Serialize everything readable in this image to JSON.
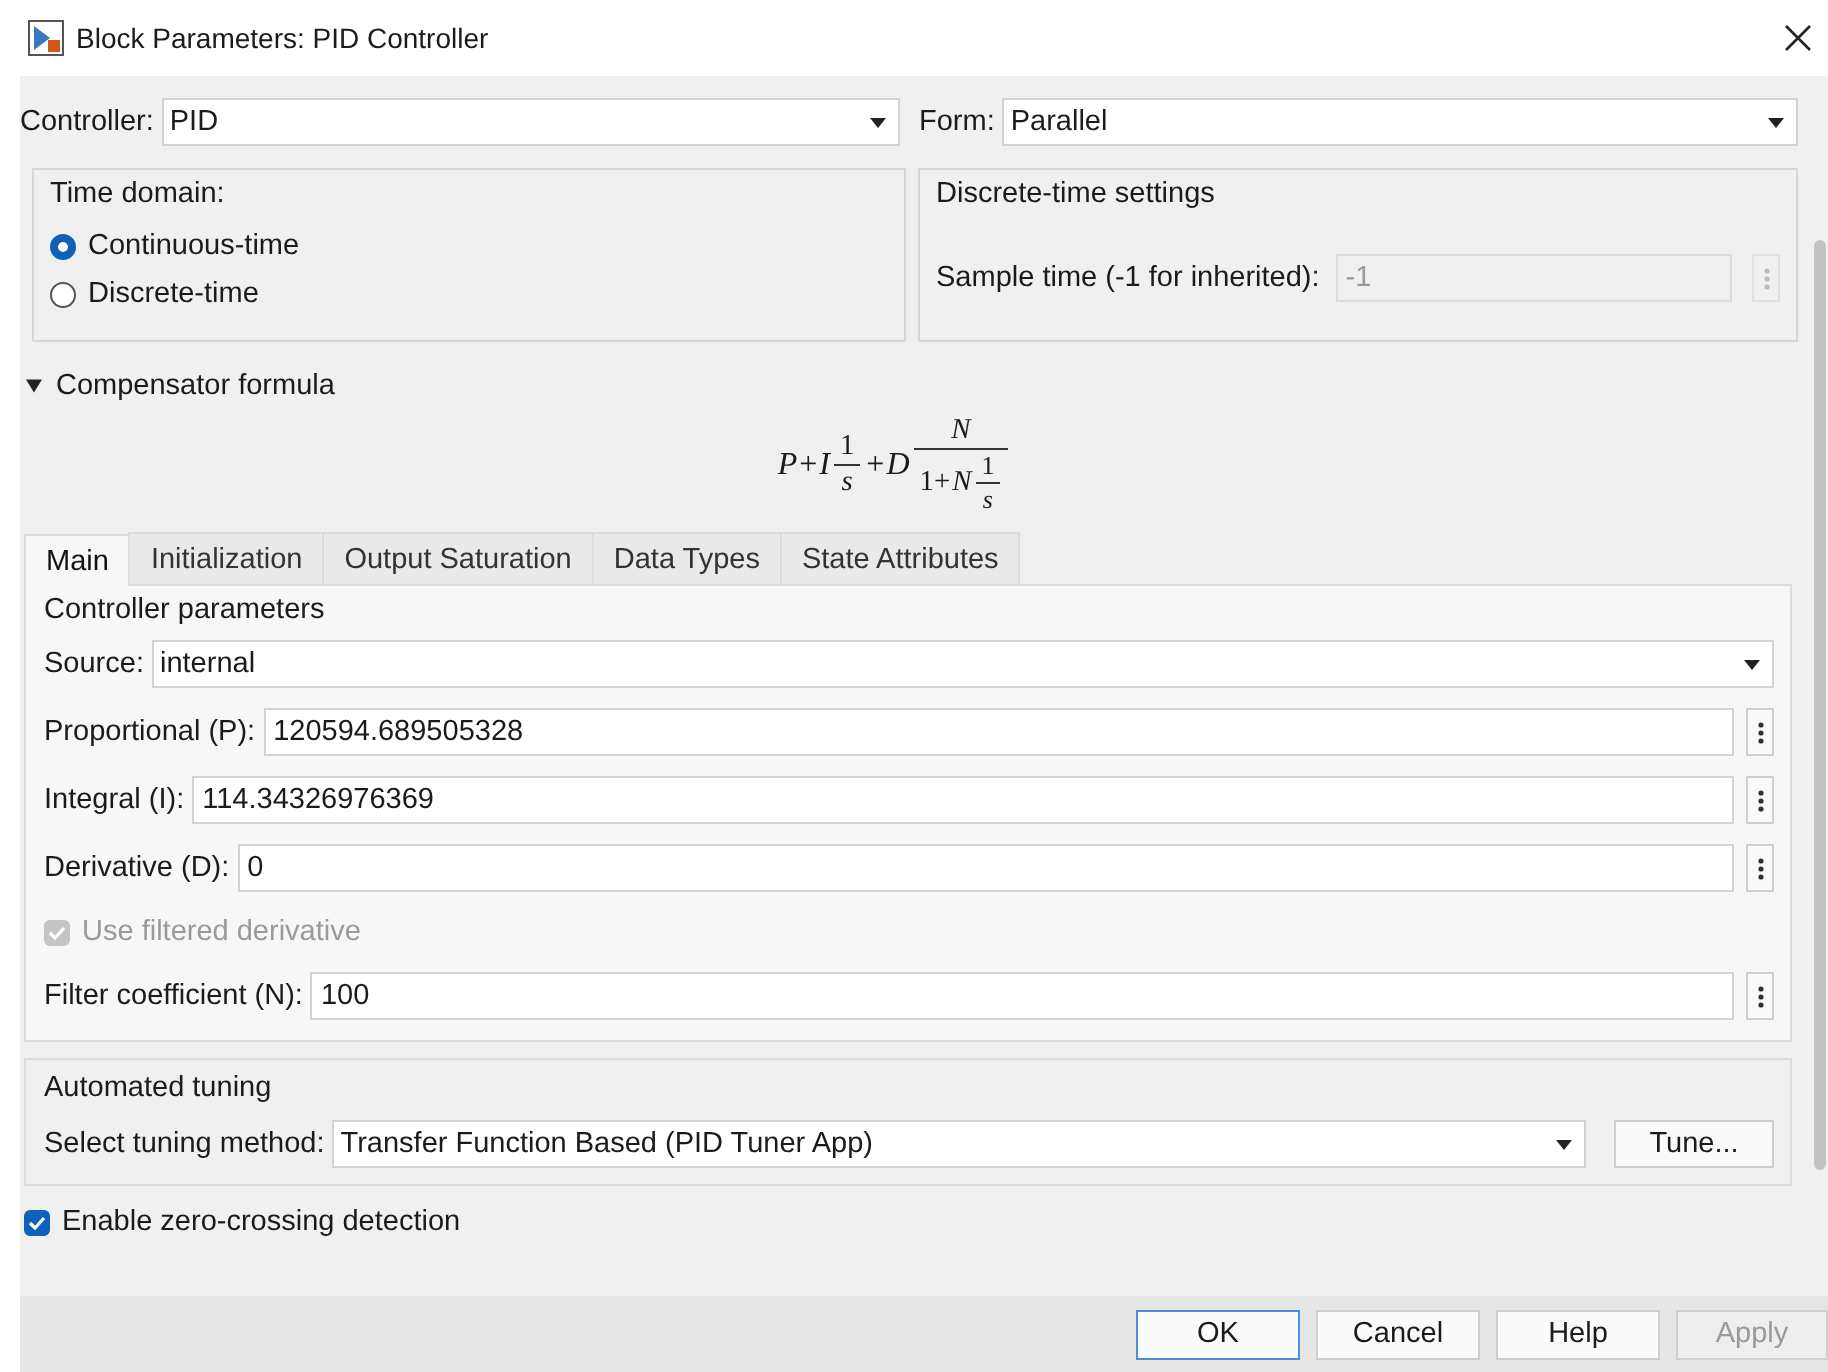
{
  "window": {
    "title": "Block Parameters: PID Controller"
  },
  "controller": {
    "label": "Controller:",
    "value": "PID"
  },
  "form": {
    "label": "Form:",
    "value": "Parallel"
  },
  "time_domain": {
    "title": "Time domain:",
    "options": [
      {
        "label": "Continuous-time",
        "selected": true
      },
      {
        "label": "Discrete-time",
        "selected": false
      }
    ]
  },
  "discrete_settings": {
    "title": "Discrete-time settings",
    "label": "Sample time (-1 for inherited):",
    "value": "-1",
    "disabled": true
  },
  "compensator": {
    "title": "Compensator formula",
    "expanded": true,
    "formula": [
      {
        "kind": "var",
        "text": "P"
      },
      {
        "kind": "op",
        "text": "+"
      },
      {
        "kind": "var",
        "text": "I"
      },
      {
        "kind": "frac",
        "num": [
          {
            "kind": "op",
            "text": "1"
          }
        ],
        "den": [
          {
            "kind": "var",
            "text": "s"
          }
        ]
      },
      {
        "kind": "op",
        "text": "+"
      },
      {
        "kind": "var",
        "text": "D"
      },
      {
        "kind": "frac",
        "num": [
          {
            "kind": "var",
            "text": "N"
          }
        ],
        "den": [
          {
            "kind": "op",
            "text": "1+"
          },
          {
            "kind": "var",
            "text": "N"
          },
          {
            "kind": "frac",
            "num": [
              {
                "kind": "op",
                "text": "1"
              }
            ],
            "den": [
              {
                "kind": "var",
                "text": "s"
              }
            ]
          }
        ]
      }
    ]
  },
  "tabs": [
    {
      "label": "Main",
      "selected": true
    },
    {
      "label": "Initialization",
      "selected": false
    },
    {
      "label": "Output Saturation",
      "selected": false
    },
    {
      "label": "Data Types",
      "selected": false
    },
    {
      "label": "State Attributes",
      "selected": false
    }
  ],
  "controller_parameters": {
    "title": "Controller parameters",
    "rows": [
      {
        "kind": "dropdown",
        "label": "Source:",
        "value": "internal"
      },
      {
        "kind": "field",
        "label": "Proportional (P):",
        "value": "120594.689505328"
      },
      {
        "kind": "field",
        "label": "Integral (I):",
        "value": "114.34326976369"
      },
      {
        "kind": "field",
        "label": "Derivative (D):",
        "value": "0"
      },
      {
        "kind": "checkbox",
        "label": "Use filtered derivative",
        "checked": true,
        "disabled": true
      },
      {
        "kind": "field",
        "label": "Filter coefficient (N):",
        "value": "100"
      }
    ]
  },
  "automated_tuning": {
    "title": "Automated tuning",
    "label": "Select tuning method:",
    "value": "Transfer Function Based (PID Tuner App)",
    "button": "Tune..."
  },
  "zero_crossing": {
    "label": "Enable zero-crossing detection",
    "checked": true
  },
  "buttons": [
    {
      "label": "OK",
      "default": true,
      "disabled": false
    },
    {
      "label": "Cancel",
      "default": false,
      "disabled": false
    },
    {
      "label": "Help",
      "default": false,
      "disabled": false
    },
    {
      "label": "Apply",
      "default": false,
      "disabled": true
    }
  ]
}
